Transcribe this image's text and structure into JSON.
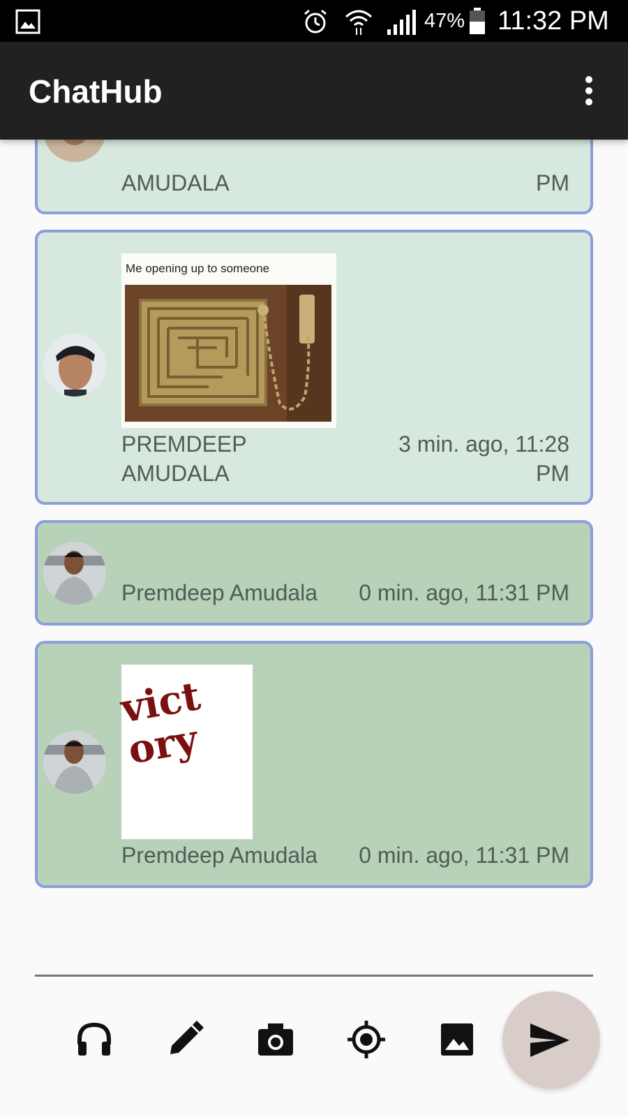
{
  "status_bar": {
    "battery_percent": "47%",
    "time": "11:32 PM"
  },
  "app_bar": {
    "title": "ChatHub",
    "menu_icon": "more-vert-icon"
  },
  "messages": [
    {
      "sender": "AMUDALA",
      "time": "PM",
      "type": "text"
    },
    {
      "sender": "PREMDEEP AMUDALA",
      "time": "3 min. ago, 11:28 PM",
      "type": "image",
      "image_caption": "Me opening up to someone"
    },
    {
      "sender": "Premdeep Amudala",
      "time": "0 min. ago, 11:31 PM",
      "type": "text"
    },
    {
      "sender": "Premdeep Amudala",
      "time": "0 min. ago, 11:31 PM",
      "type": "drawing",
      "drawing_text": "vict ory"
    }
  ],
  "toolbar": {
    "icons": [
      "headphones-icon",
      "pencil-icon",
      "camera-icon",
      "location-icon",
      "image-icon"
    ],
    "send_icon": "send-icon"
  },
  "colors": {
    "app_bar": "#212121",
    "bubble_border": "#8c9edb",
    "bubble_light": "#d7e8df",
    "bubble_dark": "#b7d2b8",
    "send_button": "#d8cdc9"
  }
}
